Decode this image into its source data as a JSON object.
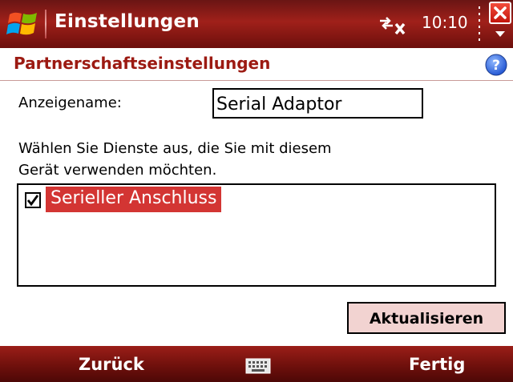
{
  "titlebar": {
    "title": "Einstellungen",
    "time": "10:10",
    "icons": [
      "windows-start-icon",
      "connectivity-icon",
      "close-icon",
      "chevron-down-icon"
    ]
  },
  "header": {
    "title": "Partnerschaftseinstellungen",
    "help_icon": "help-icon"
  },
  "form": {
    "display_name_label": "Anzeigename:",
    "display_name_value": "Serial Adaptor",
    "instructions_line1": "Wählen Sie Dienste aus, die Sie mit diesem",
    "instructions_line2": "Gerät verwenden möchten.",
    "services": [
      {
        "label": "Serieller Anschluss",
        "checked": true,
        "selected": true
      }
    ],
    "update_button": "Aktualisieren"
  },
  "softkeys": {
    "left": "Zurück",
    "center_icon": "keyboard-icon",
    "right": "Fertig"
  },
  "colors": {
    "title_bar": "#a0201a",
    "header_text": "#9c1a12",
    "selection": "#d33533",
    "button_bg": "#f2d3d1"
  }
}
